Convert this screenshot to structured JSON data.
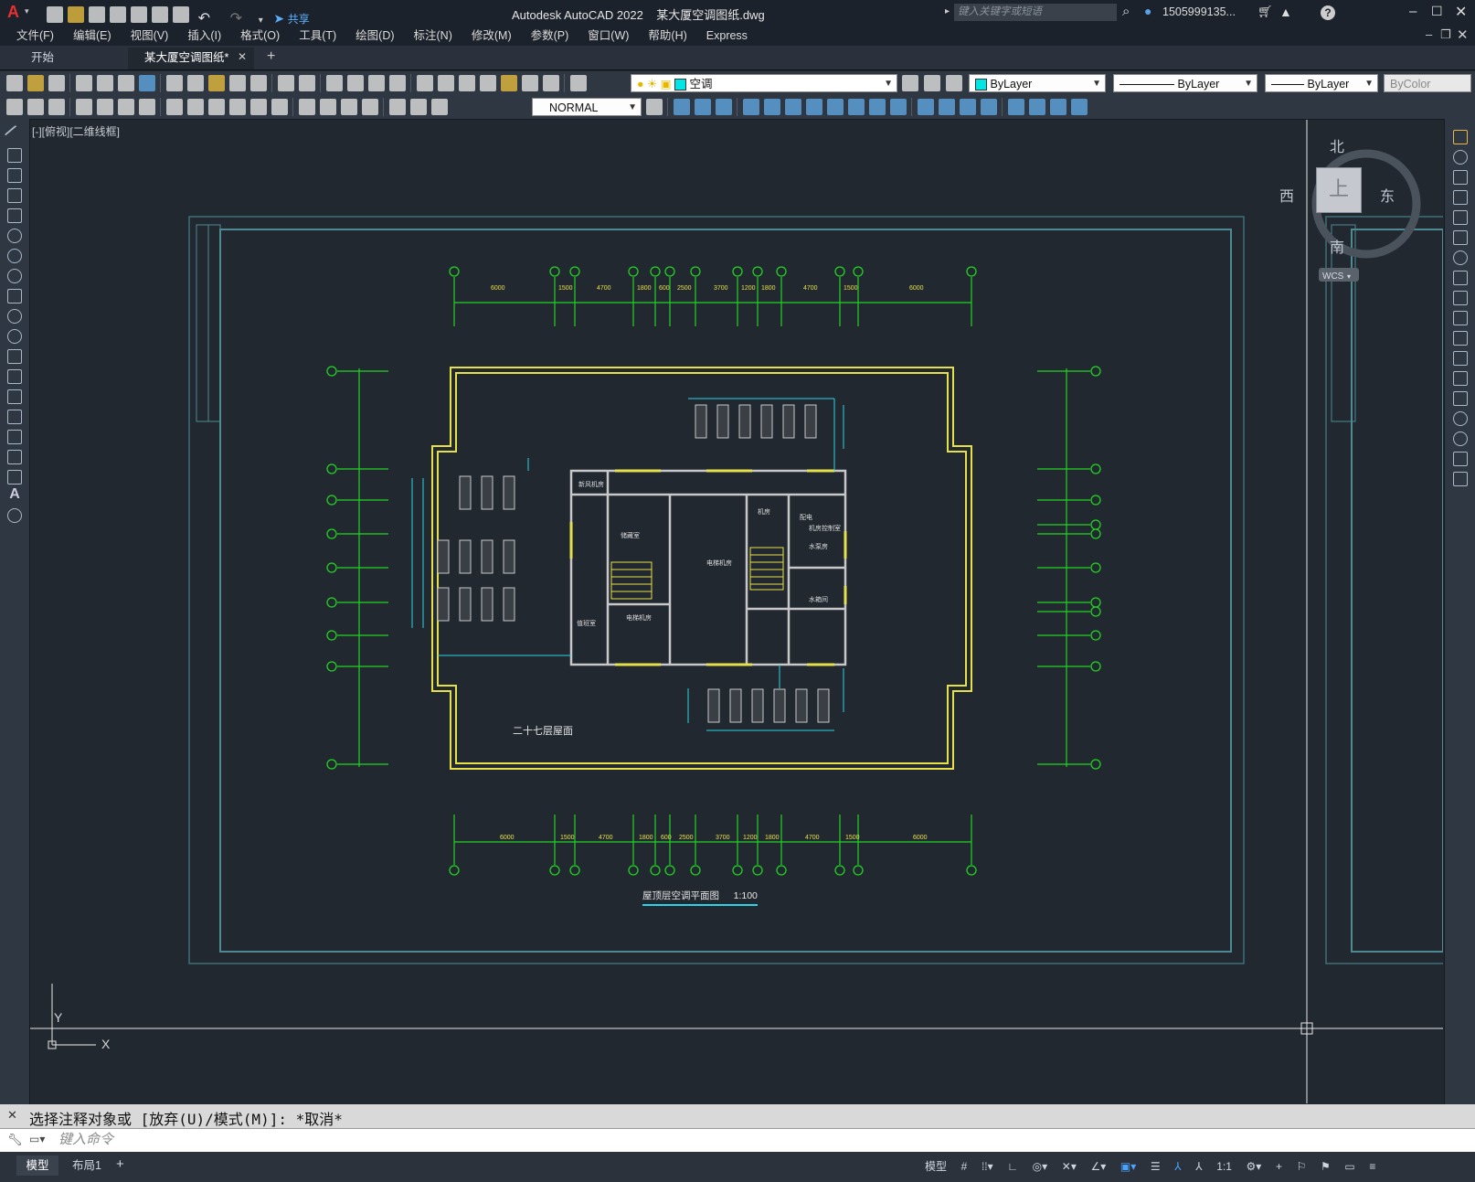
{
  "titlebar": {
    "app_logo": "A",
    "share_label": "共享",
    "title": "Autodesk AutoCAD 2022    某大厦空调图纸.dwg",
    "search_placeholder": "键入关键字或短语",
    "user": "1505999135...",
    "help": "?"
  },
  "menu": [
    "文件(F)",
    "编辑(E)",
    "视图(V)",
    "插入(I)",
    "格式(O)",
    "工具(T)",
    "绘图(D)",
    "标注(N)",
    "修改(M)",
    "参数(P)",
    "窗口(W)",
    "帮助(H)",
    "Express"
  ],
  "tabs": {
    "start": "开始",
    "active": "某大厦空调图纸*",
    "add": "+"
  },
  "toolbar": {
    "layer_value": "空调",
    "color_value": "ByLayer",
    "linetype_value": "ByLayer",
    "lineweight_value": "ByLayer",
    "plotstyle_value": "ByColor",
    "dimstyle_value": "NORMAL"
  },
  "viewport": {
    "label": "[-][俯视][二维线框]",
    "viewcube_north": "北",
    "viewcube_south": "南",
    "viewcube_east": "东",
    "viewcube_west": "西",
    "viewcube_top": "上",
    "wcs": "WCS",
    "ucs_x": "X",
    "ucs_y": "Y"
  },
  "drawing": {
    "floor_label": "二十七层屋面",
    "plan_title": "屋顶层空调平面图",
    "scale": "1:100",
    "top_dims": [
      "6000",
      "1500",
      "4700",
      "1800",
      "600",
      "2500",
      "3700",
      "1200",
      "1800",
      "4700",
      "1500",
      "6000"
    ],
    "bottom_dims": [
      "6000",
      "1500",
      "4700",
      "1800",
      "600",
      "2500",
      "3700",
      "1200",
      "1800",
      "4700",
      "1500",
      "6000"
    ],
    "rooms": [
      "新风机房",
      "电梯机房",
      "电梯机房",
      "储藏室",
      "机房",
      "配电",
      "水泵房",
      "水箱间",
      "机房控制室",
      "值班室"
    ]
  },
  "command": {
    "history": "选择注释对象或 [放弃(U)/模式(M)]: *取消*",
    "placeholder": "键入命令"
  },
  "status": {
    "model_tab": "模型",
    "layout_tab": "布局1",
    "add_tab": "+",
    "model_btn": "模型",
    "scale": "1:1"
  },
  "colors": {
    "background": "#212830",
    "grid_green": "#22d322",
    "wall_yellow": "#e6e04a",
    "equip_cyan": "#2ad4e6",
    "wall_white": "#c8c8c8",
    "frame_teal": "#4f8a93"
  }
}
